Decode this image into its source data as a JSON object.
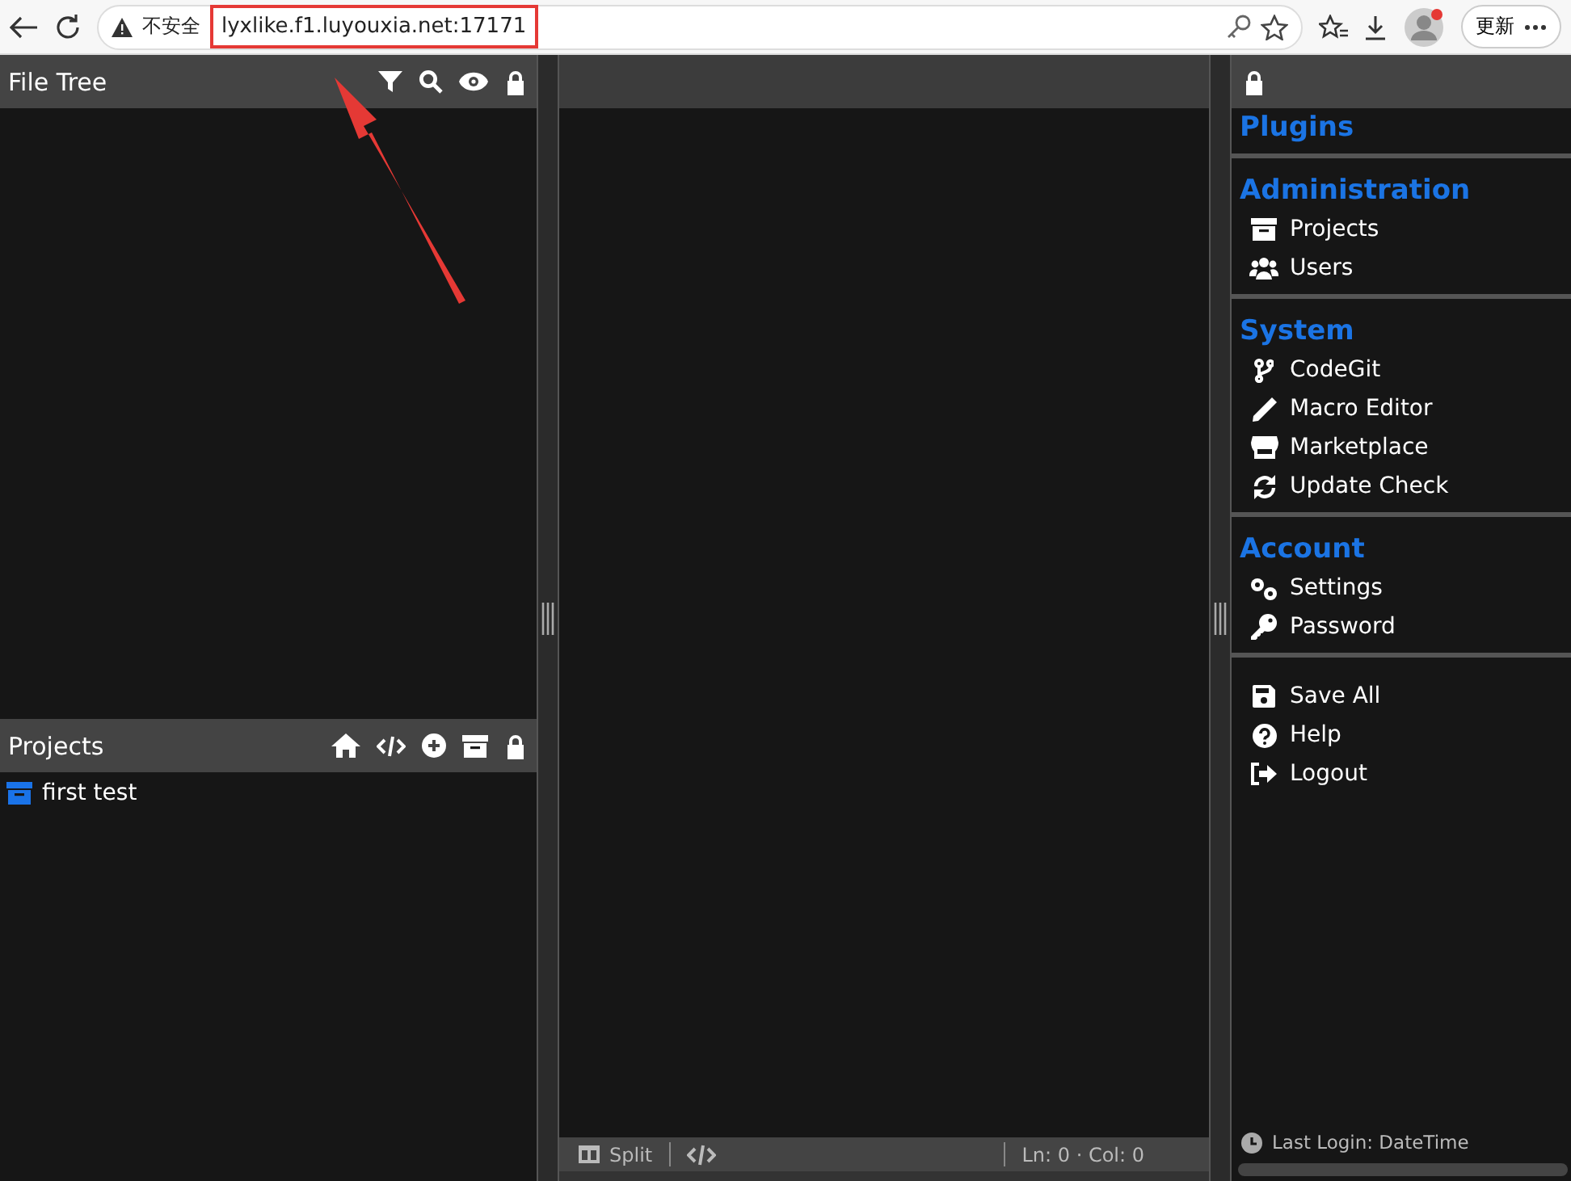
{
  "browser": {
    "security_label": "不安全",
    "url": "lyxlike.f1.luyouxia.net:17171",
    "update_button": "更新"
  },
  "file_tree": {
    "title": "File Tree"
  },
  "projects": {
    "title": "Projects",
    "items": [
      {
        "label": "first test"
      }
    ]
  },
  "editor": {
    "status_bar": {
      "split": "Split",
      "position": "Ln: 0 · Col: 0"
    }
  },
  "menu": {
    "sections": [
      {
        "heading": "Plugins"
      },
      {
        "heading": "Administration",
        "items": [
          {
            "label": "Projects"
          },
          {
            "label": "Users"
          }
        ]
      },
      {
        "heading": "System",
        "items": [
          {
            "label": "CodeGit"
          },
          {
            "label": "Macro Editor"
          },
          {
            "label": "Marketplace"
          },
          {
            "label": "Update Check"
          }
        ]
      },
      {
        "heading": "Account",
        "items": [
          {
            "label": "Settings"
          },
          {
            "label": "Password"
          }
        ]
      },
      {
        "items": [
          {
            "label": "Save All"
          },
          {
            "label": "Help"
          },
          {
            "label": "Logout"
          }
        ]
      }
    ],
    "last_login": "Last Login: DateTime"
  }
}
